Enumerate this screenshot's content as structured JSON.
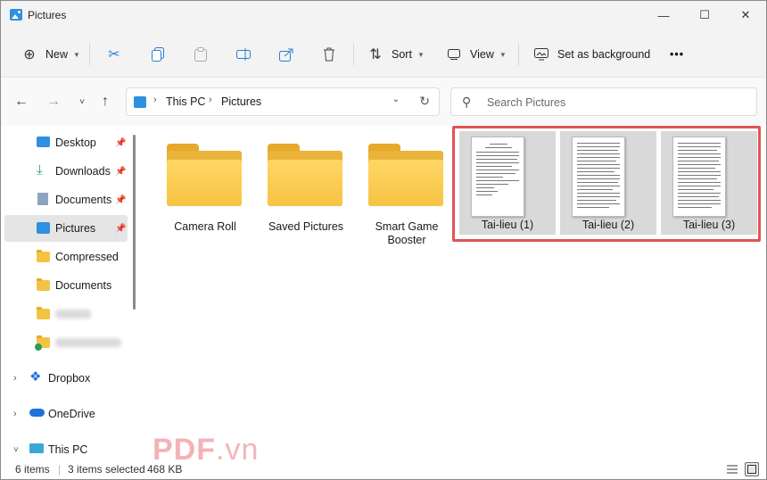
{
  "window": {
    "title": "Pictures",
    "controls": {
      "minimize": "—",
      "maximize": "☐",
      "close": "✕"
    }
  },
  "toolbar": {
    "new_label": "New",
    "sort_label": "Sort",
    "view_label": "View",
    "set_background_label": "Set as background",
    "more_label": "•••"
  },
  "address": {
    "crumbs": [
      "This PC",
      "Pictures"
    ],
    "search_placeholder": "Search Pictures"
  },
  "sidebar": {
    "quick_access": [
      {
        "label": "Desktop",
        "icon": "desktop-icon",
        "pinned": true
      },
      {
        "label": "Downloads",
        "icon": "download-icon",
        "pinned": true
      },
      {
        "label": "Documents",
        "icon": "documents-icon",
        "pinned": true
      },
      {
        "label": "Pictures",
        "icon": "pictures-icon",
        "pinned": true,
        "selected": true
      },
      {
        "label": "Compressed",
        "icon": "folder-icon",
        "pinned": false
      },
      {
        "label": "Documents",
        "icon": "folder-icon",
        "pinned": false
      }
    ],
    "roots": [
      {
        "label": "Dropbox",
        "icon": "dropbox-icon"
      },
      {
        "label": "OneDrive",
        "icon": "onedrive-icon"
      },
      {
        "label": "This PC",
        "icon": "this-pc-icon"
      }
    ]
  },
  "content": {
    "folders": [
      "Camera Roll",
      "Saved Pictures",
      "Smart Game\nBooster"
    ],
    "documents": [
      "Tai-lieu (1)",
      "Tai-lieu (2)",
      "Tai-lieu (3)"
    ]
  },
  "status": {
    "items": "6 items",
    "selected": "3 items selected",
    "size": "468 KB"
  },
  "watermark": {
    "main": "PDF",
    "suffix": ".vn"
  },
  "colors": {
    "accent": "#2f8fe0",
    "folder": "#f6c343",
    "selection_highlight": "#e05555",
    "watermark": "#f3b2b6"
  }
}
